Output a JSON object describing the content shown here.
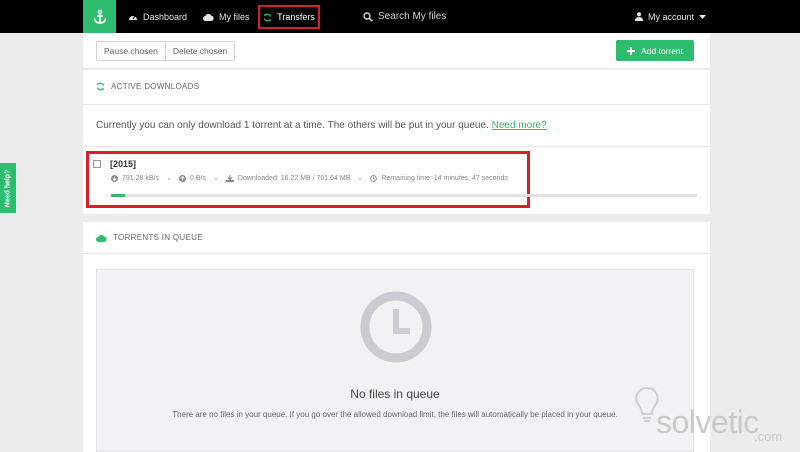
{
  "colors": {
    "accent": "#2ebd6e",
    "highlight": "#d9202a",
    "nav_bg": "#000000"
  },
  "nav": {
    "logo_icon": "anchor-icon",
    "dashboard": "Dashboard",
    "my_files": "My files",
    "transfers": "Transfers",
    "search_placeholder": "Search My files",
    "account": "My account"
  },
  "toolbar": {
    "pause_chosen": "Pause chosen",
    "delete_chosen": "Delete chosen",
    "add_torrent": "Add torrent"
  },
  "active_downloads": {
    "title": "ACTIVE DOWNLOADS",
    "notice": "Currently you can only download 1 torrent at a time. The others will be put in your queue.",
    "notice_link": "Need more?",
    "torrent": {
      "name": "[2015]",
      "download_speed": "791.28 kB/s",
      "upload_speed": "0 B/s",
      "downloaded": "Downloaded: 16.22 MB / 701.64 MB",
      "remaining": "Remaining time: 14 minutes, 47 seconds",
      "progress_fraction": 0.0231
    }
  },
  "queue": {
    "title": "TORRENTS IN QUEUE",
    "empty_title": "No files in queue",
    "empty_desc": "There are no files in your queue. If you go over the allowed download limit, the files will automatically be placed in your queue."
  },
  "help_tab": "Need help?",
  "watermark": {
    "text": "olvetic",
    "suffix": ".com",
    "prefix_letter": "s"
  }
}
